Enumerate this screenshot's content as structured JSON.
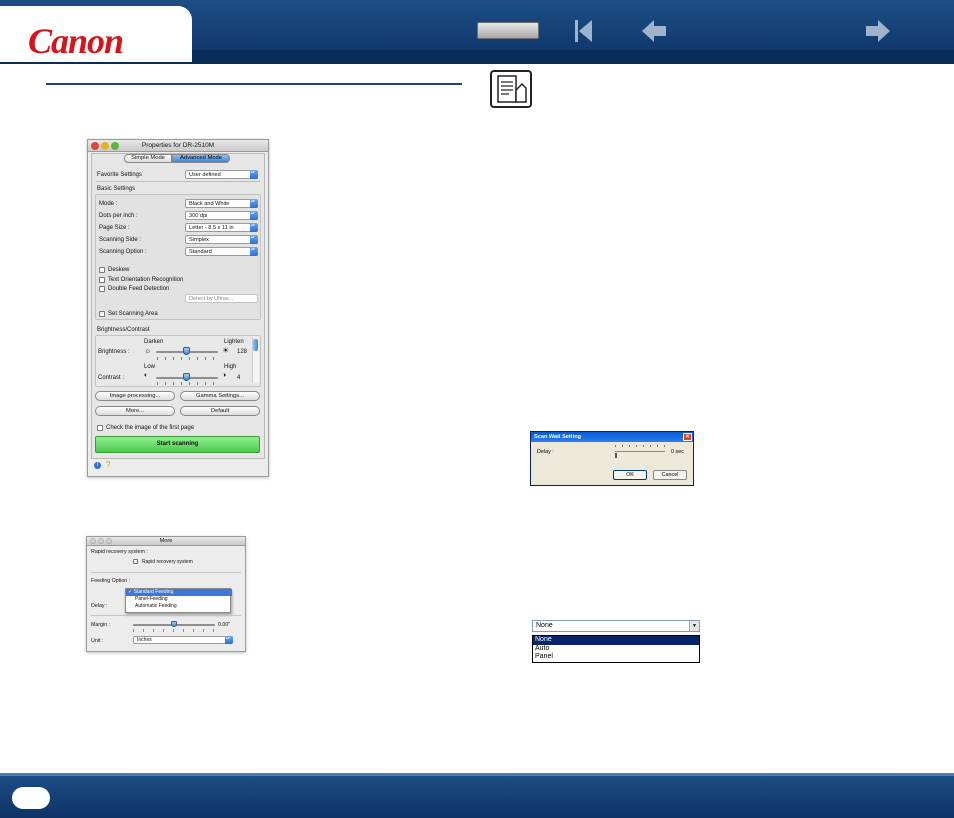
{
  "header": {
    "brand": "Canon",
    "nav_icons": [
      "contents-button",
      "first-page-icon",
      "back-arrow-icon",
      "forward-arrow-icon"
    ]
  },
  "properties_window": {
    "title": "Properties for DR-2510M",
    "tabs": [
      "Simple Mode",
      "Advanced Mode"
    ],
    "favorite_settings_label": "Favorite Settings",
    "favorite_settings_value": "User defined",
    "basic_settings_heading": "Basic Settings",
    "fields": [
      {
        "label": "Mode :",
        "value": "Black and White"
      },
      {
        "label": "Dots per inch :",
        "value": "300 dpi"
      },
      {
        "label": "Page Size :",
        "value": "Letter - 8.5 x 11 in"
      },
      {
        "label": "Scanning Side :",
        "value": "Simplex"
      },
      {
        "label": "Scanning Option :",
        "value": "Standard"
      }
    ],
    "checkboxes": [
      "Deskew",
      "Text Orientation Recognition",
      "Double Feed Detection"
    ],
    "detect_value": "Detect by Ultras...",
    "set_scanning_area": "Set Scanning Area",
    "brightness_contrast_heading": "Brightness/Contrast",
    "darken": "Darken",
    "lighten": "Lighten",
    "brightness_label": "Brightness :",
    "brightness_value": "128",
    "low": "Low",
    "high": "High",
    "contrast_label": "Contrast :",
    "contrast_value": "4",
    "buttons": [
      "Image processing...",
      "Gamma Settings...",
      "More...",
      "Default"
    ],
    "check_first_page": "Check the image of the first page",
    "start_scanning": "Start scanning"
  },
  "more_window": {
    "title": "More",
    "rapid_heading": "Rapid recovery system :",
    "rapid_checkbox": "Rapid recovery system",
    "feeding_heading": "Feeding Option :",
    "feeding_options": [
      "Standard Feeding",
      "Panel-Feeding",
      "Automatic Feeding"
    ],
    "selected_check": "✓",
    "delay_label": "Delay :",
    "margin_label": "Margin :",
    "margin_value": "0.00\"",
    "unit_label": "Unit :",
    "unit_value": "Inches"
  },
  "scan_wait_dialog": {
    "title": "Scan Wait Setting",
    "delay_label": "Delay :",
    "delay_value": "0 sec",
    "ok": "OK",
    "cancel": "Cancel"
  },
  "win_combo": {
    "value": "None",
    "options": [
      "None",
      "Auto",
      "Panel"
    ]
  }
}
